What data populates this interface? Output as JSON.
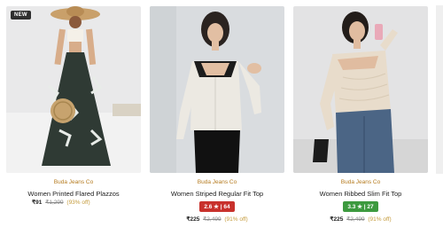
{
  "products": [
    {
      "badge": "NEW",
      "brand": "Buda Jeans Co",
      "name": "Women Printed Flared Plazzos",
      "price": "₹91",
      "mrp": "₹1,299",
      "discount": "(93% off)"
    },
    {
      "brand": "Buda Jeans Co",
      "name": "Women Striped Regular Fit Top",
      "rating": "2.6 ★ | 64",
      "rating_color": "#c8312c",
      "price": "₹225",
      "mrp": "₹2,499",
      "discount": "(91% off)"
    },
    {
      "brand": "Buda Jeans Co",
      "name": "Women Ribbed Slim Fit Top",
      "rating": "3.3 ★ | 27",
      "rating_color": "#3d9a3f",
      "price": "₹225",
      "mrp": "₹2,499",
      "discount": "(91% off)"
    }
  ]
}
